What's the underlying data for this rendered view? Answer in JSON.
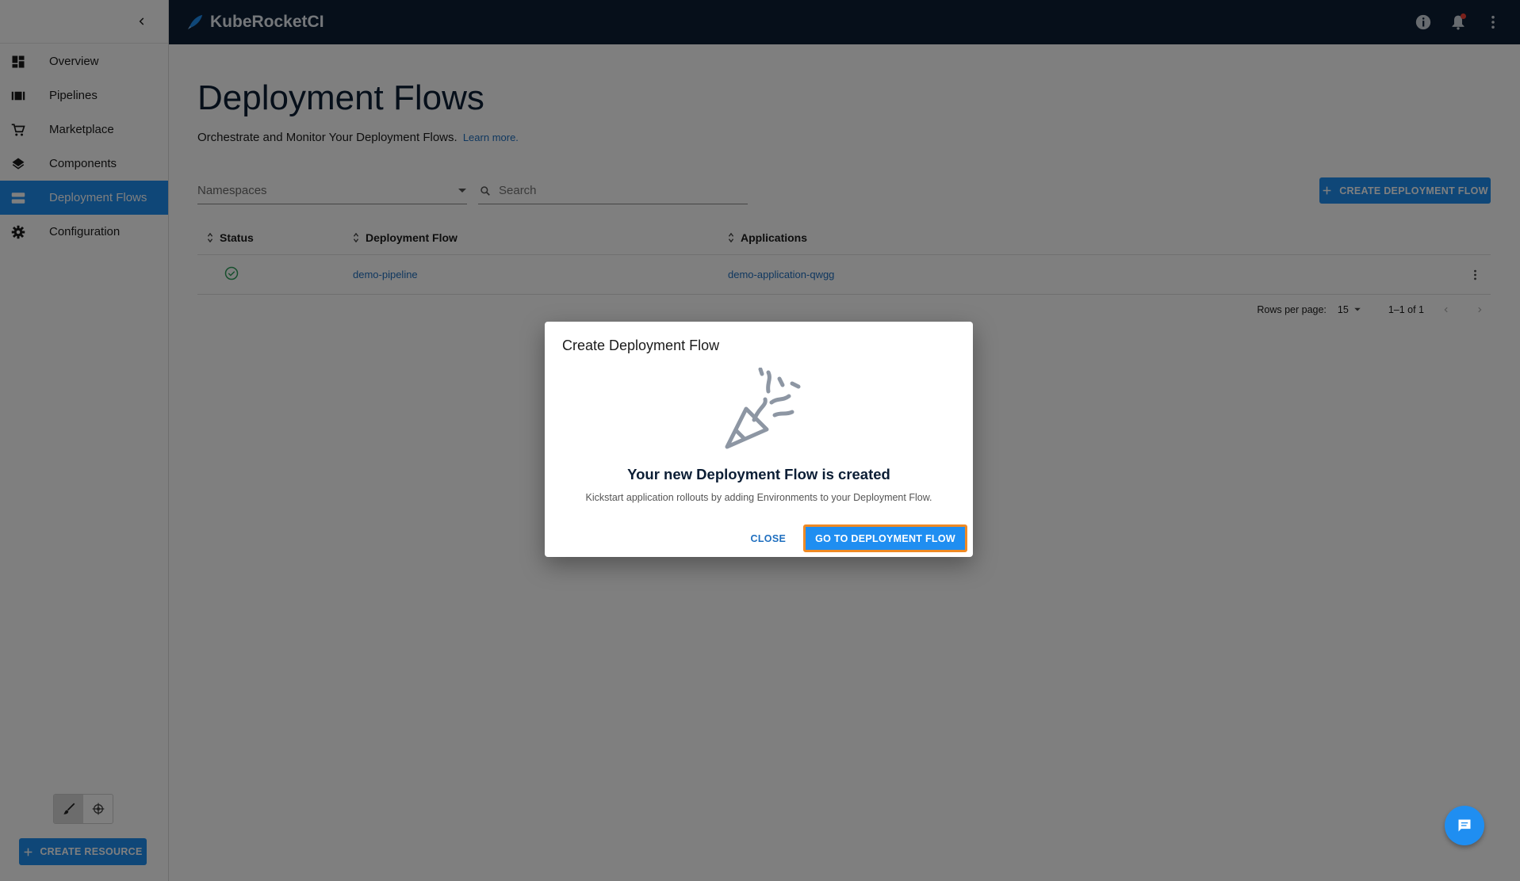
{
  "app": {
    "brand": "KubeRocketCI"
  },
  "sidebar": {
    "items": [
      {
        "label": "Overview",
        "icon": "dashboard-icon",
        "active": false
      },
      {
        "label": "Pipelines",
        "icon": "pipelines-icon",
        "active": false
      },
      {
        "label": "Marketplace",
        "icon": "cart-icon",
        "active": false
      },
      {
        "label": "Components",
        "icon": "layers-icon",
        "active": false
      },
      {
        "label": "Deployment Flows",
        "icon": "deployment-flows-icon",
        "active": true
      },
      {
        "label": "Configuration",
        "icon": "gear-icon",
        "active": false
      }
    ],
    "create_resource_label": "CREATE RESOURCE"
  },
  "main": {
    "title": "Deployment Flows",
    "subtitle": "Orchestrate and Monitor Your Deployment Flows.",
    "learn_more": "Learn more.",
    "namespaces_placeholder": "Namespaces",
    "search_placeholder": "Search",
    "create_button_label": "CREATE DEPLOYMENT FLOW",
    "table": {
      "columns": [
        "Status",
        "Deployment Flow",
        "Applications"
      ],
      "rows": [
        {
          "status": "success",
          "flow": "demo-pipeline",
          "applications": "demo-application-qwgg"
        }
      ]
    },
    "pagination": {
      "rows_per_page_label": "Rows per page:",
      "rows_per_page": "15",
      "range": "1–1 of 1"
    }
  },
  "dialog": {
    "title": "Create Deployment Flow",
    "heading": "Your new Deployment Flow is created",
    "text": "Kickstart application rollouts by adding Environments to your Deployment Flow.",
    "close_label": "CLOSE",
    "primary_label": "GO TO DEPLOYMENT FLOW"
  },
  "colors": {
    "accent": "#1f8ef1",
    "topbar": "#0c1e35",
    "highlight_outline": "#f08a24",
    "success": "#2e9e5b"
  }
}
